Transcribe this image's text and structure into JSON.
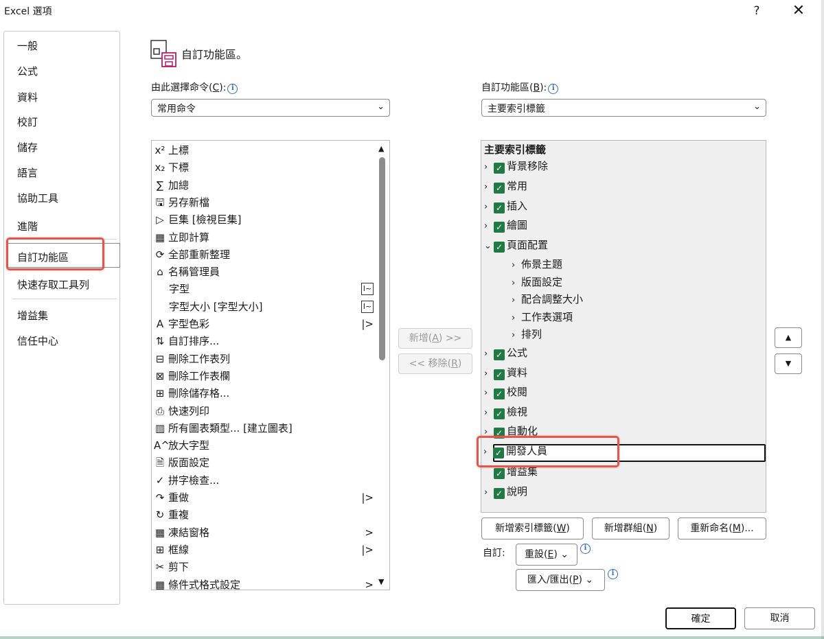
{
  "window": {
    "title": "Excel 選項",
    "help": "?",
    "close": "✕"
  },
  "nav": {
    "items": [
      "一般",
      "公式",
      "資料",
      "校訂",
      "儲存",
      "語言",
      "協助工具",
      "進階",
      "自訂功能區",
      "快速存取工具列",
      "增益集",
      "信任中心"
    ],
    "selected": "自訂功能區"
  },
  "header": {
    "text": "自訂功能區。"
  },
  "choose": {
    "label_pre": "由此選擇命令(",
    "label_key": "C",
    "label_post": "):",
    "value": "常用命令"
  },
  "customize": {
    "label_pre": "自訂功能區(",
    "label_key": "B",
    "label_post": "):",
    "value": "主要索引標籤"
  },
  "commands": [
    {
      "icon": "superscript-icon",
      "glyph": "x²",
      "label": "上標",
      "sub": ""
    },
    {
      "icon": "subscript-icon",
      "glyph": "x₂",
      "label": "下標",
      "sub": ""
    },
    {
      "icon": "sum-icon",
      "glyph": "∑",
      "label": "加總",
      "sub": ""
    },
    {
      "icon": "save-as-icon",
      "glyph": "🖫",
      "label": "另存新檔",
      "sub": ""
    },
    {
      "icon": "macro-icon",
      "glyph": "▷",
      "label": "巨集 [檢視巨集]",
      "sub": ""
    },
    {
      "icon": "calculator-icon",
      "glyph": "▦",
      "label": "立即計算",
      "sub": ""
    },
    {
      "icon": "refresh-all-icon",
      "glyph": "⟳",
      "label": "全部重新整理",
      "sub": ""
    },
    {
      "icon": "name-manager-icon",
      "glyph": "⌂",
      "label": "名稱管理員",
      "sub": ""
    },
    {
      "icon": "",
      "glyph": "",
      "label": "字型",
      "sub": "box"
    },
    {
      "icon": "",
      "glyph": "",
      "label": "字型大小 [字型大小]",
      "sub": "box"
    },
    {
      "icon": "font-color-icon",
      "glyph": "A",
      "label": "字型色彩",
      "sub": "|>"
    },
    {
      "icon": "sort-icon",
      "glyph": "⇅",
      "label": "自訂排序...",
      "sub": ""
    },
    {
      "icon": "delete-row-icon",
      "glyph": "⊟",
      "label": "刪除工作表列",
      "sub": ""
    },
    {
      "icon": "delete-column-icon",
      "glyph": "⊠",
      "label": "刪除工作表欄",
      "sub": ""
    },
    {
      "icon": "delete-cells-icon",
      "glyph": "⊞",
      "label": "刪除儲存格...",
      "sub": ""
    },
    {
      "icon": "quick-print-icon",
      "glyph": "⎙",
      "label": "快速列印",
      "sub": ""
    },
    {
      "icon": "chart-icon",
      "glyph": "▥",
      "label": "所有圖表類型... [建立圖表]",
      "sub": ""
    },
    {
      "icon": "grow-font-icon",
      "glyph": "A^",
      "label": "放大字型",
      "sub": ""
    },
    {
      "icon": "page-setup-icon",
      "glyph": "🗎",
      "label": "版面設定",
      "sub": ""
    },
    {
      "icon": "spelling-icon",
      "glyph": "✓",
      "label": "拼字檢查...",
      "sub": ""
    },
    {
      "icon": "redo-icon",
      "glyph": "↷",
      "label": "重做",
      "sub": "|>"
    },
    {
      "icon": "repeat-icon",
      "glyph": "↻",
      "label": "重複",
      "sub": ""
    },
    {
      "icon": "freeze-panes-icon",
      "glyph": "▦",
      "label": "凍結窗格",
      "sub": ">"
    },
    {
      "icon": "borders-icon",
      "glyph": "⊞",
      "label": "框線",
      "sub": "|>"
    },
    {
      "icon": "cut-icon",
      "glyph": "✂",
      "label": "剪下",
      "sub": ""
    },
    {
      "icon": "conditional-format-icon",
      "glyph": "▦",
      "label": "條件式格式設定",
      "sub": ">"
    }
  ],
  "add_button": {
    "pre": "新增(",
    "key": "A",
    "post": ") >>"
  },
  "remove_button": {
    "pre": "<< 移除(",
    "key": "R",
    "post": ")"
  },
  "tree": {
    "root": "主要索引標籤",
    "nodes": [
      {
        "label": "背景移除",
        "level": 0,
        "exp": ">",
        "check": true
      },
      {
        "label": "常用",
        "level": 0,
        "exp": ">",
        "check": true
      },
      {
        "label": "插入",
        "level": 0,
        "exp": ">",
        "check": true
      },
      {
        "label": "繪圖",
        "level": 0,
        "exp": ">",
        "check": true
      },
      {
        "label": "頁面配置",
        "level": 0,
        "exp": "v",
        "check": true
      },
      {
        "label": "佈景主題",
        "level": 1,
        "exp": ">",
        "check": false
      },
      {
        "label": "版面設定",
        "level": 1,
        "exp": ">",
        "check": false
      },
      {
        "label": "配合調整大小",
        "level": 1,
        "exp": ">",
        "check": false
      },
      {
        "label": "工作表選項",
        "level": 1,
        "exp": ">",
        "check": false
      },
      {
        "label": "排列",
        "level": 1,
        "exp": ">",
        "check": false
      },
      {
        "label": "公式",
        "level": 0,
        "exp": ">",
        "check": true
      },
      {
        "label": "資料",
        "level": 0,
        "exp": ">",
        "check": true
      },
      {
        "label": "校閱",
        "level": 0,
        "exp": ">",
        "check": true
      },
      {
        "label": "檢視",
        "level": 0,
        "exp": ">",
        "check": true
      },
      {
        "label": "自動化",
        "level": 0,
        "exp": ">",
        "check": true
      },
      {
        "label": "開發人員",
        "level": 0,
        "exp": ">",
        "check": true
      },
      {
        "label": "增益集",
        "level": 0,
        "exp": "",
        "check": true
      },
      {
        "label": "說明",
        "level": 0,
        "exp": ">",
        "check": true
      }
    ]
  },
  "tree_buttons": {
    "new_tab": {
      "pre": "新增索引標籤(",
      "key": "W",
      "post": ")"
    },
    "new_group": {
      "pre": "新增群組(",
      "key": "N",
      "post": ")"
    },
    "rename": {
      "pre": "重新命名(",
      "key": "M",
      "post": ")..."
    }
  },
  "customizations": {
    "label": "自訂:",
    "reset": {
      "pre": "重設(",
      "key": "E",
      "post": ") ⌄"
    },
    "import_export": {
      "pre": "匯入/匯出(",
      "key": "P",
      "post": ") ⌄"
    }
  },
  "footer": {
    "ok": "確定",
    "cancel": "取消"
  },
  "colors": {
    "highlight": "#e8534a",
    "check": "#1f7a45",
    "info": "#2d6fb5"
  }
}
